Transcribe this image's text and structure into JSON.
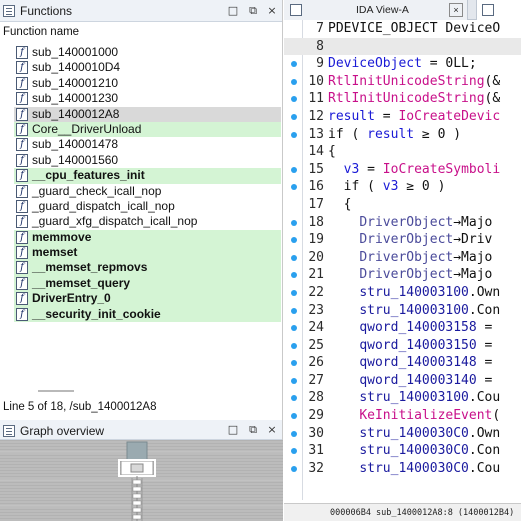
{
  "functions_panel": {
    "title": "Functions",
    "buttons": [
      "□",
      "⧉",
      "×"
    ],
    "column_header": "Function name",
    "items": [
      {
        "name": "sub_140001000",
        "highlight": "none",
        "bold": false
      },
      {
        "name": "sub_1400010D4",
        "highlight": "none",
        "bold": false
      },
      {
        "name": "sub_140001210",
        "highlight": "none",
        "bold": false
      },
      {
        "name": "sub_140001230",
        "highlight": "none",
        "bold": false
      },
      {
        "name": "sub_1400012A8",
        "highlight": "selected",
        "bold": false
      },
      {
        "name": "Core__DriverUnload",
        "highlight": "green",
        "bold": false
      },
      {
        "name": "sub_140001478",
        "highlight": "none",
        "bold": false
      },
      {
        "name": "sub_140001560",
        "highlight": "none",
        "bold": false
      },
      {
        "name": "__cpu_features_init",
        "highlight": "green",
        "bold": true
      },
      {
        "name": "_guard_check_icall_nop",
        "highlight": "none",
        "bold": false
      },
      {
        "name": "_guard_dispatch_icall_nop",
        "highlight": "none",
        "bold": false
      },
      {
        "name": "_guard_xfg_dispatch_icall_nop",
        "highlight": "none",
        "bold": false
      },
      {
        "name": "memmove",
        "highlight": "green",
        "bold": true
      },
      {
        "name": "memset",
        "highlight": "green",
        "bold": true
      },
      {
        "name": "__memset_repmovs",
        "highlight": "green",
        "bold": true
      },
      {
        "name": "__memset_query",
        "highlight": "green",
        "bold": true
      },
      {
        "name": "DriverEntry_0",
        "highlight": "green",
        "bold": true
      },
      {
        "name": "__security_init_cookie",
        "highlight": "green",
        "bold": true
      }
    ],
    "item_icon_glyph": "f",
    "status": "Line 5 of 18, /sub_1400012A8"
  },
  "graph_panel": {
    "title": "Graph overview",
    "buttons": [
      "□",
      "⧉",
      "×"
    ]
  },
  "code_panel": {
    "tabs": [
      {
        "label": "IDA View-A",
        "close": "×"
      },
      {
        "label": ""
      }
    ],
    "lines": [
      {
        "no": "7",
        "dot": false,
        "gray": false,
        "parts": [
          {
            "c": "kw",
            "t": "PDEVICE_OBJECT DeviceO"
          }
        ]
      },
      {
        "no": "8",
        "dot": false,
        "gray": true,
        "parts": []
      },
      {
        "no": "9",
        "dot": true,
        "gray": false,
        "parts": [
          {
            "c": "var",
            "t": "DeviceObject"
          },
          {
            "c": "kw",
            "t": " = 0LL;"
          }
        ]
      },
      {
        "no": "10",
        "dot": true,
        "gray": false,
        "parts": [
          {
            "c": "fn",
            "t": "RtlInitUnicodeString"
          },
          {
            "c": "kw",
            "t": "(&"
          }
        ]
      },
      {
        "no": "11",
        "dot": true,
        "gray": false,
        "parts": [
          {
            "c": "fn",
            "t": "RtlInitUnicodeString"
          },
          {
            "c": "kw",
            "t": "(&"
          }
        ]
      },
      {
        "no": "12",
        "dot": true,
        "gray": false,
        "parts": [
          {
            "c": "var",
            "t": "result"
          },
          {
            "c": "kw",
            "t": " = "
          },
          {
            "c": "fn",
            "t": "IoCreateDevic"
          }
        ]
      },
      {
        "no": "13",
        "dot": true,
        "gray": false,
        "parts": [
          {
            "c": "kw",
            "t": "if ( "
          },
          {
            "c": "var",
            "t": "result"
          },
          {
            "c": "kw",
            "t": " ≥ 0 )"
          }
        ]
      },
      {
        "no": "14",
        "dot": false,
        "gray": false,
        "parts": [
          {
            "c": "kw",
            "t": "{"
          }
        ]
      },
      {
        "no": "15",
        "dot": true,
        "gray": false,
        "parts": [
          {
            "c": "kw",
            "t": "  "
          },
          {
            "c": "var",
            "t": "v3"
          },
          {
            "c": "kw",
            "t": " = "
          },
          {
            "c": "fn",
            "t": "IoCreateSymboli"
          }
        ]
      },
      {
        "no": "16",
        "dot": true,
        "gray": false,
        "parts": [
          {
            "c": "kw",
            "t": "  if ( "
          },
          {
            "c": "var",
            "t": "v3"
          },
          {
            "c": "kw",
            "t": " ≥ 0 )"
          }
        ]
      },
      {
        "no": "17",
        "dot": false,
        "gray": false,
        "parts": [
          {
            "c": "kw",
            "t": "  {"
          }
        ]
      },
      {
        "no": "18",
        "dot": true,
        "gray": false,
        "parts": [
          {
            "c": "kw",
            "t": "    "
          },
          {
            "c": "param",
            "t": "DriverObject"
          },
          {
            "c": "kw",
            "t": "→Majo"
          }
        ]
      },
      {
        "no": "19",
        "dot": true,
        "gray": false,
        "parts": [
          {
            "c": "kw",
            "t": "    "
          },
          {
            "c": "param",
            "t": "DriverObject"
          },
          {
            "c": "kw",
            "t": "→Driv"
          }
        ]
      },
      {
        "no": "20",
        "dot": true,
        "gray": false,
        "parts": [
          {
            "c": "kw",
            "t": "    "
          },
          {
            "c": "param",
            "t": "DriverObject"
          },
          {
            "c": "kw",
            "t": "→Majo"
          }
        ]
      },
      {
        "no": "21",
        "dot": true,
        "gray": false,
        "parts": [
          {
            "c": "kw",
            "t": "    "
          },
          {
            "c": "param",
            "t": "DriverObject"
          },
          {
            "c": "kw",
            "t": "→Majo"
          }
        ]
      },
      {
        "no": "22",
        "dot": true,
        "gray": false,
        "parts": [
          {
            "c": "kw",
            "t": "    "
          },
          {
            "c": "gvar",
            "t": "stru_140003100"
          },
          {
            "c": "kw",
            "t": ".Own"
          }
        ]
      },
      {
        "no": "23",
        "dot": true,
        "gray": false,
        "parts": [
          {
            "c": "kw",
            "t": "    "
          },
          {
            "c": "gvar",
            "t": "stru_140003100"
          },
          {
            "c": "kw",
            "t": ".Con"
          }
        ]
      },
      {
        "no": "24",
        "dot": true,
        "gray": false,
        "parts": [
          {
            "c": "kw",
            "t": "    "
          },
          {
            "c": "gvar",
            "t": "qword_140003158"
          },
          {
            "c": "kw",
            "t": " ="
          }
        ]
      },
      {
        "no": "25",
        "dot": true,
        "gray": false,
        "parts": [
          {
            "c": "kw",
            "t": "    "
          },
          {
            "c": "gvar",
            "t": "qword_140003150"
          },
          {
            "c": "kw",
            "t": " ="
          }
        ]
      },
      {
        "no": "26",
        "dot": true,
        "gray": false,
        "parts": [
          {
            "c": "kw",
            "t": "    "
          },
          {
            "c": "gvar",
            "t": "qword_140003148"
          },
          {
            "c": "kw",
            "t": " ="
          }
        ]
      },
      {
        "no": "27",
        "dot": true,
        "gray": false,
        "parts": [
          {
            "c": "kw",
            "t": "    "
          },
          {
            "c": "gvar",
            "t": "qword_140003140"
          },
          {
            "c": "kw",
            "t": " ="
          }
        ]
      },
      {
        "no": "28",
        "dot": true,
        "gray": false,
        "parts": [
          {
            "c": "kw",
            "t": "    "
          },
          {
            "c": "gvar",
            "t": "stru_140003100"
          },
          {
            "c": "kw",
            "t": ".Cou"
          }
        ]
      },
      {
        "no": "29",
        "dot": true,
        "gray": false,
        "parts": [
          {
            "c": "kw",
            "t": "    "
          },
          {
            "c": "fn",
            "t": "KeInitializeEvent"
          },
          {
            "c": "kw",
            "t": "("
          }
        ]
      },
      {
        "no": "30",
        "dot": true,
        "gray": false,
        "parts": [
          {
            "c": "kw",
            "t": "    "
          },
          {
            "c": "gvar",
            "t": "stru_1400030C0"
          },
          {
            "c": "kw",
            "t": ".Own"
          }
        ]
      },
      {
        "no": "31",
        "dot": true,
        "gray": false,
        "parts": [
          {
            "c": "kw",
            "t": "    "
          },
          {
            "c": "gvar",
            "t": "stru_1400030C0"
          },
          {
            "c": "kw",
            "t": ".Con"
          }
        ]
      },
      {
        "no": "32",
        "dot": true,
        "gray": false,
        "parts": [
          {
            "c": "kw",
            "t": "    "
          },
          {
            "c": "gvar",
            "t": "stru_1400030C0"
          },
          {
            "c": "kw",
            "t": ".Cou"
          }
        ]
      }
    ],
    "status": "000006B4 sub_1400012A8:8 (1400012B4)"
  },
  "colors": {
    "green_highlight": "#d4f4d4",
    "selected_highlight": "#d9d9d9",
    "breakpoint_dot": "#2aa0ee",
    "function_call": "#c8108a",
    "variable": "#1a1ad6"
  }
}
